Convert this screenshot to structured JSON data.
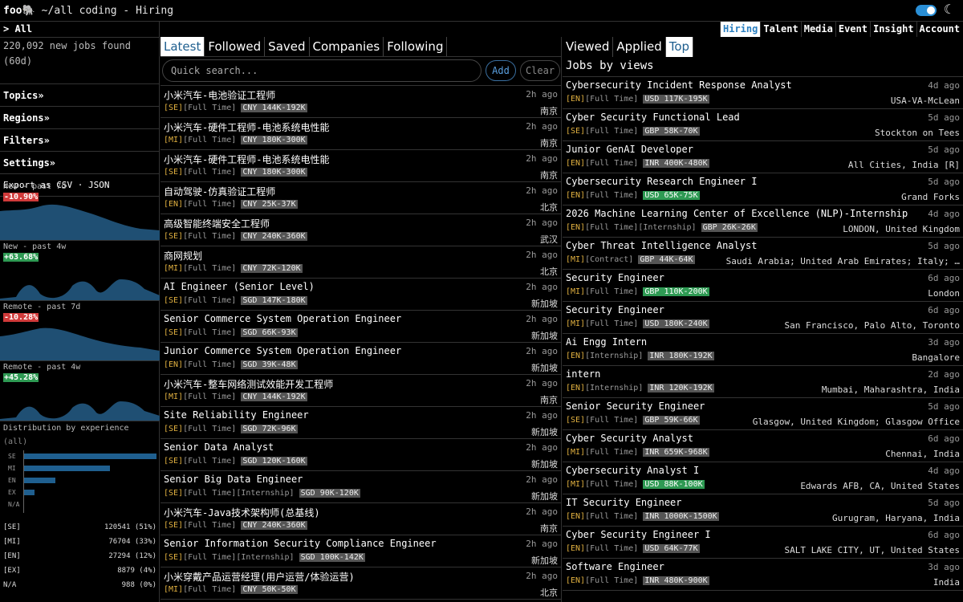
{
  "app": {
    "logo": "foo🐘",
    "path": "~/all coding - Hiring"
  },
  "nav": [
    "Hiring",
    "Talent",
    "Media",
    "Event",
    "Insight",
    "Account"
  ],
  "sidebar": {
    "all": "> All",
    "found": "220,092 new jobs found (60d)",
    "menus": [
      "Topics»",
      "Regions»",
      "Filters»",
      "Settings»"
    ],
    "export": "Export as CSV · JSON",
    "sparks": [
      {
        "label": "New - past 7d",
        "change": "-10.90%",
        "dir": "neg"
      },
      {
        "label": "New - past 4w",
        "change": "+63.68%",
        "dir": "pos"
      },
      {
        "label": "Remote - past 7d",
        "change": "-10.28%",
        "dir": "neg"
      },
      {
        "label": "Remote - past 4w",
        "change": "+45.28%",
        "dir": "pos"
      }
    ],
    "dist_title": "Distribution by experience",
    "dist_sub": "(all)",
    "dist_bars": [
      {
        "label": "SE",
        "frac": 0.51
      },
      {
        "label": "MI",
        "frac": 0.33
      },
      {
        "label": "EN",
        "frac": 0.12
      },
      {
        "label": "EX",
        "frac": 0.04
      },
      {
        "label": "N/A",
        "frac": 0.0
      }
    ],
    "dist_legend": [
      {
        "k": "[SE]",
        "v": "120541 (51%)"
      },
      {
        "k": "[MI]",
        "v": "76704 (33%)"
      },
      {
        "k": "[EN]",
        "v": "27294 (12%)"
      },
      {
        "k": "[EX]",
        "v": "8879 (4%)"
      },
      {
        "k": "N/A",
        "v": "988 (0%)"
      }
    ]
  },
  "mid": {
    "tabs": [
      "Latest",
      "Followed",
      "Saved",
      "Companies",
      "Following"
    ],
    "search_placeholder": "Quick search...",
    "add": "Add",
    "clear": "Clear",
    "jobs": [
      {
        "title": "小米汽车-电池验证工程师",
        "time": "2h ago",
        "lvl": "[SE]",
        "type": "[Full Time]",
        "sal": "CNY 144K-192K",
        "loc": "南京"
      },
      {
        "title": "小米汽车-硬件工程师-电池系统电性能",
        "time": "2h ago",
        "lvl": "[MI]",
        "type": "[Full Time]",
        "sal": "CNY 180K-300K",
        "loc": "南京"
      },
      {
        "title": "小米汽车-硬件工程师-电池系统电性能",
        "time": "2h ago",
        "lvl": "[SE]",
        "type": "[Full Time]",
        "sal": "CNY 180K-300K",
        "loc": "南京"
      },
      {
        "title": "自动驾驶-仿真验证工程师",
        "time": "2h ago",
        "lvl": "[EN]",
        "type": "[Full Time]",
        "sal": "CNY 25K-37K",
        "loc": "北京"
      },
      {
        "title": "高级智能终端安全工程师",
        "time": "2h ago",
        "lvl": "[SE]",
        "type": "[Full Time]",
        "sal": "CNY 240K-360K",
        "loc": "武汉"
      },
      {
        "title": "商网规划",
        "time": "2h ago",
        "lvl": "[MI]",
        "type": "[Full Time]",
        "sal": "CNY 72K-120K",
        "loc": "北京"
      },
      {
        "title": "AI Engineer (Senior Level)",
        "time": "2h ago",
        "lvl": "[SE]",
        "type": "[Full Time]",
        "sal": "SGD 147K-180K",
        "loc": "新加坡"
      },
      {
        "title": "Senior Commerce System Operation Engineer",
        "time": "2h ago",
        "lvl": "[SE]",
        "type": "[Full Time]",
        "sal": "SGD 66K-93K",
        "loc": "新加坡"
      },
      {
        "title": "Junior Commerce System Operation Engineer",
        "time": "2h ago",
        "lvl": "[EN]",
        "type": "[Full Time]",
        "sal": "SGD 39K-48K",
        "loc": "新加坡"
      },
      {
        "title": "小米汽车-整车网络测试效能开发工程师",
        "time": "2h ago",
        "lvl": "[MI]",
        "type": "[Full Time]",
        "sal": "CNY 144K-192K",
        "loc": "南京"
      },
      {
        "title": "Site Reliability Engineer",
        "time": "2h ago",
        "lvl": "[SE]",
        "type": "[Full Time]",
        "sal": "SGD 72K-96K",
        "loc": "新加坡"
      },
      {
        "title": "Senior Data Analyst",
        "time": "2h ago",
        "lvl": "[SE]",
        "type": "[Full Time]",
        "sal": "SGD 120K-160K",
        "loc": "新加坡"
      },
      {
        "title": "Senior Big Data Engineer",
        "time": "2h ago",
        "lvl": "[SE]",
        "type": "[Full Time][Internship]",
        "sal": "SGD 90K-120K",
        "loc": "新加坡"
      },
      {
        "title": "小米汽车-Java技术架构师(总基线)",
        "time": "2h ago",
        "lvl": "[SE]",
        "type": "[Full Time]",
        "sal": "CNY 240K-360K",
        "loc": "南京"
      },
      {
        "title": "Senior Information Security Compliance Engineer",
        "time": "2h ago",
        "lvl": "[SE]",
        "type": "[Full Time][Internship]",
        "sal": "SGD 100K-142K",
        "loc": "新加坡"
      },
      {
        "title": "小米穿戴产品运营经理(用户运营/体验运营)",
        "time": "2h ago",
        "lvl": "[MI]",
        "type": "[Full Time]",
        "sal": "CNY 50K-50K",
        "loc": "北京"
      }
    ]
  },
  "right": {
    "tabs": [
      "Viewed",
      "Applied",
      "Top"
    ],
    "heading": "Jobs by views",
    "jobs": [
      {
        "title": "Cybersecurity Incident Response Analyst",
        "time": "4d ago",
        "lvl": "[EN]",
        "type": "[Full Time]",
        "sal": "USD 117K-195K",
        "green": false,
        "loc": "USA-VA-McLean"
      },
      {
        "title": "Cyber Security Functional Lead",
        "time": "5d ago",
        "lvl": "[SE]",
        "type": "[Full Time]",
        "sal": "GBP 58K-70K",
        "green": false,
        "loc": "Stockton on Tees"
      },
      {
        "title": "Junior GenAI Developer",
        "time": "5d ago",
        "lvl": "[EN]",
        "type": "[Full Time]",
        "sal": "INR 400K-480K",
        "green": false,
        "loc": "All Cities, India [R]"
      },
      {
        "title": "Cybersecurity Research Engineer I",
        "time": "5d ago",
        "lvl": "[EN]",
        "type": "[Full Time]",
        "sal": "USD 65K-75K",
        "green": true,
        "loc": "Grand Forks"
      },
      {
        "title": "2026 Machine Learning Center of Excellence (NLP)-Internship",
        "time": "4d ago",
        "lvl": "[EN]",
        "type": "[Full Time][Internship]",
        "sal": "GBP 26K-26K",
        "green": false,
        "loc": "LONDON, United Kingdom"
      },
      {
        "title": "Cyber Threat Intelligence Analyst",
        "time": "5d ago",
        "lvl": "[MI]",
        "type": "[Contract]",
        "sal": "GBP 44K-64K",
        "green": false,
        "loc": "Saudi Arabia; United Arab Emirates; Italy; …"
      },
      {
        "title": "Security Engineer",
        "time": "6d ago",
        "lvl": "[MI]",
        "type": "[Full Time]",
        "sal": "GBP 110K-200K",
        "green": true,
        "loc": "London"
      },
      {
        "title": "Security Engineer",
        "time": "6d ago",
        "lvl": "[MI]",
        "type": "[Full Time]",
        "sal": "USD 180K-240K",
        "green": false,
        "loc": "San Francisco, Palo Alto, Toronto"
      },
      {
        "title": "Ai Engg Intern",
        "time": "3d ago",
        "lvl": "[EN]",
        "type": "[Internship]",
        "sal": "INR 180K-192K",
        "green": false,
        "loc": "Bangalore"
      },
      {
        "title": "intern",
        "time": "2d ago",
        "lvl": "[EN]",
        "type": "[Internship]",
        "sal": "INR 120K-192K",
        "green": false,
        "loc": "Mumbai, Maharashtra, India"
      },
      {
        "title": "Senior Security Engineer",
        "time": "5d ago",
        "lvl": "[SE]",
        "type": "[Full Time]",
        "sal": "GBP 59K-66K",
        "green": false,
        "loc": "Glasgow, United Kingdom; Glasgow Office"
      },
      {
        "title": "Cyber Security Analyst",
        "time": "6d ago",
        "lvl": "[MI]",
        "type": "[Full Time]",
        "sal": "INR 659K-968K",
        "green": false,
        "loc": "Chennai, India"
      },
      {
        "title": "Cybersecurity Analyst I",
        "time": "4d ago",
        "lvl": "[MI]",
        "type": "[Full Time]",
        "sal": "USD 88K-100K",
        "green": true,
        "loc": "Edwards AFB, CA, United States"
      },
      {
        "title": "IT Security Engineer",
        "time": "5d ago",
        "lvl": "[EN]",
        "type": "[Full Time]",
        "sal": "INR 1000K-1500K",
        "green": false,
        "loc": "Gurugram, Haryana, India"
      },
      {
        "title": "Cyber Security Engineer I",
        "time": "6d ago",
        "lvl": "[EN]",
        "type": "[Full Time]",
        "sal": "USD 64K-77K",
        "green": false,
        "loc": "SALT LAKE CITY, UT, United States"
      },
      {
        "title": "Software Engineer",
        "time": "3d ago",
        "lvl": "[EN]",
        "type": "[Full Time]",
        "sal": "INR 480K-900K",
        "green": false,
        "loc": "India"
      }
    ]
  }
}
